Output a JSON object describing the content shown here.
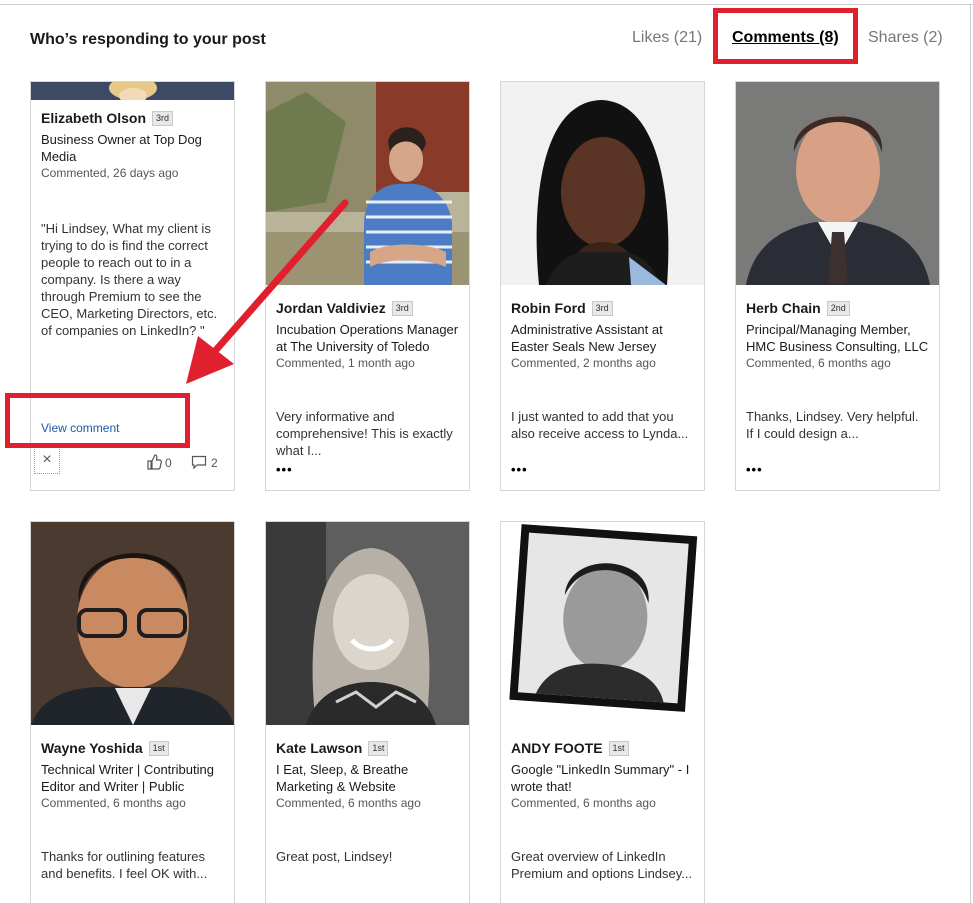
{
  "header": {
    "title": "Who’s responding to your post",
    "tabs": {
      "likes": "Likes (21)",
      "comments": "Comments (8)",
      "shares": "Shares (2)"
    }
  },
  "colors": {
    "highlight": "#e0202e",
    "link": "#1a5caa"
  },
  "cards": [
    {
      "name": "Elizabeth Olson",
      "degree": "3rd",
      "headline": "Business Owner at Top Dog Media",
      "meta": "Commented, 26 days ago",
      "comment": "\"Hi Lindsey, What my client is trying to do is find the correct people to reach out to in a company. Is there a way through Premium to see the CEO, Marketing Directors, etc. of companies on LinkedIn? \"",
      "view_comment": "View comment",
      "like_count": "0",
      "reply_count": "2",
      "close": "×"
    },
    {
      "name": "Jordan Valdiviez",
      "degree": "3rd",
      "headline": "Incubation Operations Manager at The University of Toledo",
      "meta": "Commented, 1 month ago",
      "comment": "Very informative and comprehensive! This is exactly what I...",
      "more": "•••"
    },
    {
      "name": "Robin Ford",
      "degree": "3rd",
      "headline": "Administrative Assistant at Easter Seals New Jersey",
      "meta": "Commented, 2 months ago",
      "comment": "I just wanted to add that you also receive access to Lynda...",
      "more": "•••"
    },
    {
      "name": "Herb Chain",
      "degree": "2nd",
      "headline": "Principal/Managing Member, HMC Business Consulting, LLC",
      "meta": "Commented, 6 months ago",
      "comment": "Thanks, Lindsey. Very helpful. If I could design a...",
      "more": "•••"
    },
    {
      "name": "Wayne Yoshida",
      "degree": "1st",
      "headline": "Technical Writer | Contributing Editor and Writer | Public",
      "meta": "Commented, 6 months ago",
      "comment": "Thanks for outlining features and benefits. I feel OK with..."
    },
    {
      "name": "Kate Lawson",
      "degree": "1st",
      "headline": "I Eat, Sleep, & Breathe Marketing & Website",
      "meta": "Commented, 6 months ago",
      "comment": "Great post, Lindsey!"
    },
    {
      "name": "ANDY FOOTE",
      "degree": "1st",
      "headline": "Google \"LinkedIn Summary\" - I wrote that!",
      "meta": "Commented, 6 months ago",
      "comment": "Great overview of LinkedIn Premium and options Lindsey..."
    }
  ]
}
